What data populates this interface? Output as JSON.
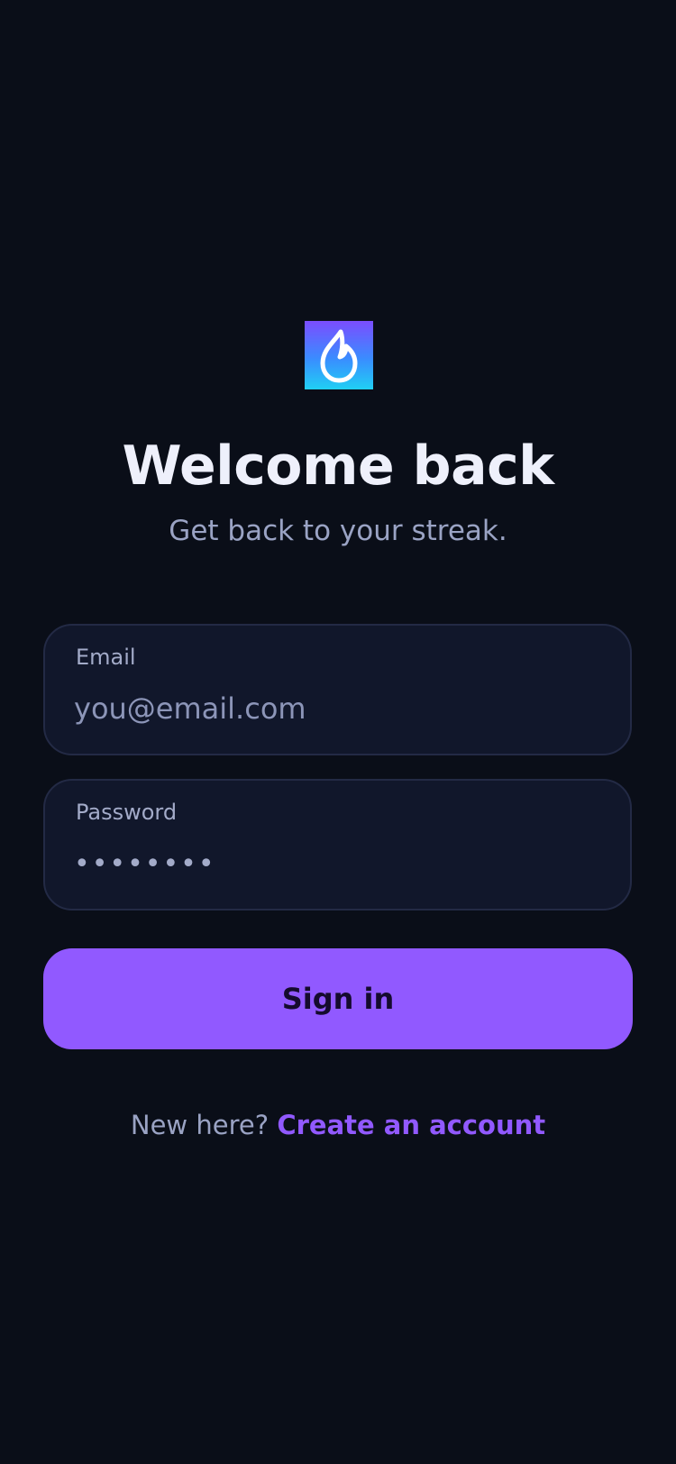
{
  "app": {
    "logo_icon": "flame-icon",
    "logo_gradient": [
      "#7b4dff",
      "#20d0f4"
    ]
  },
  "header": {
    "title": "Welcome back",
    "subtitle": "Get back to your streak."
  },
  "form": {
    "email": {
      "label": "Email",
      "value": "",
      "placeholder": "you@email.com"
    },
    "password": {
      "label": "Password",
      "value": "••••••••"
    },
    "submit_label": "Sign in"
  },
  "footer": {
    "prompt": "New here?",
    "link_label": "Create an account"
  },
  "colors": {
    "background": "#0a0e18",
    "accent": "#9159ff",
    "field_bg": "#11172b",
    "field_border": "#232a45",
    "muted_text": "#9aa3c4"
  }
}
